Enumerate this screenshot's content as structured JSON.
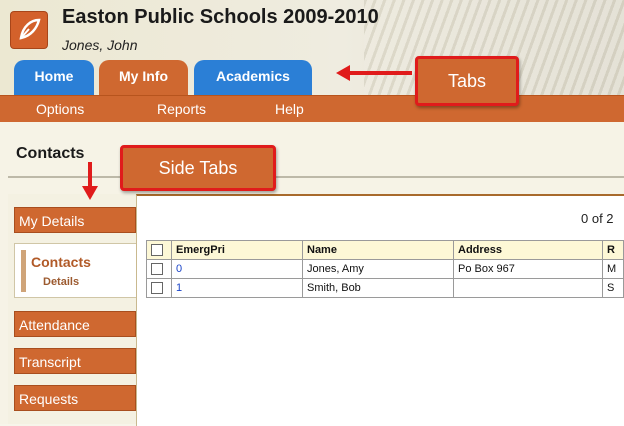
{
  "header": {
    "school_title": "Easton Public Schools 2009-2010",
    "user_name": "Jones, John"
  },
  "main_tabs": [
    {
      "label": "Home",
      "active": false
    },
    {
      "label": "My Info",
      "active": true
    },
    {
      "label": "Academics",
      "active": false
    }
  ],
  "sub_nav": [
    "Options",
    "Reports",
    "Help"
  ],
  "page_title": "Contacts",
  "side_tabs": {
    "items": [
      "My Details",
      "Attendance",
      "Transcript",
      "Requests"
    ],
    "active": {
      "label": "Contacts",
      "sub_label": "Details"
    }
  },
  "record_count": "0 of 2",
  "table": {
    "columns": [
      "EmergPri",
      "Name",
      "Address",
      "R"
    ],
    "rows": [
      {
        "emergpri": "0",
        "name": "Jones, Amy",
        "address": "Po Box 967",
        "r": "M"
      },
      {
        "emergpri": "1",
        "name": "Smith, Bob",
        "address": "",
        "r": "S"
      }
    ]
  },
  "callouts": {
    "tabs": "Tabs",
    "side_tabs": "Side Tabs"
  },
  "colors": {
    "accent_orange": "#cf6830",
    "tab_blue": "#2b7fd6",
    "callout_border": "#e01b1b"
  }
}
